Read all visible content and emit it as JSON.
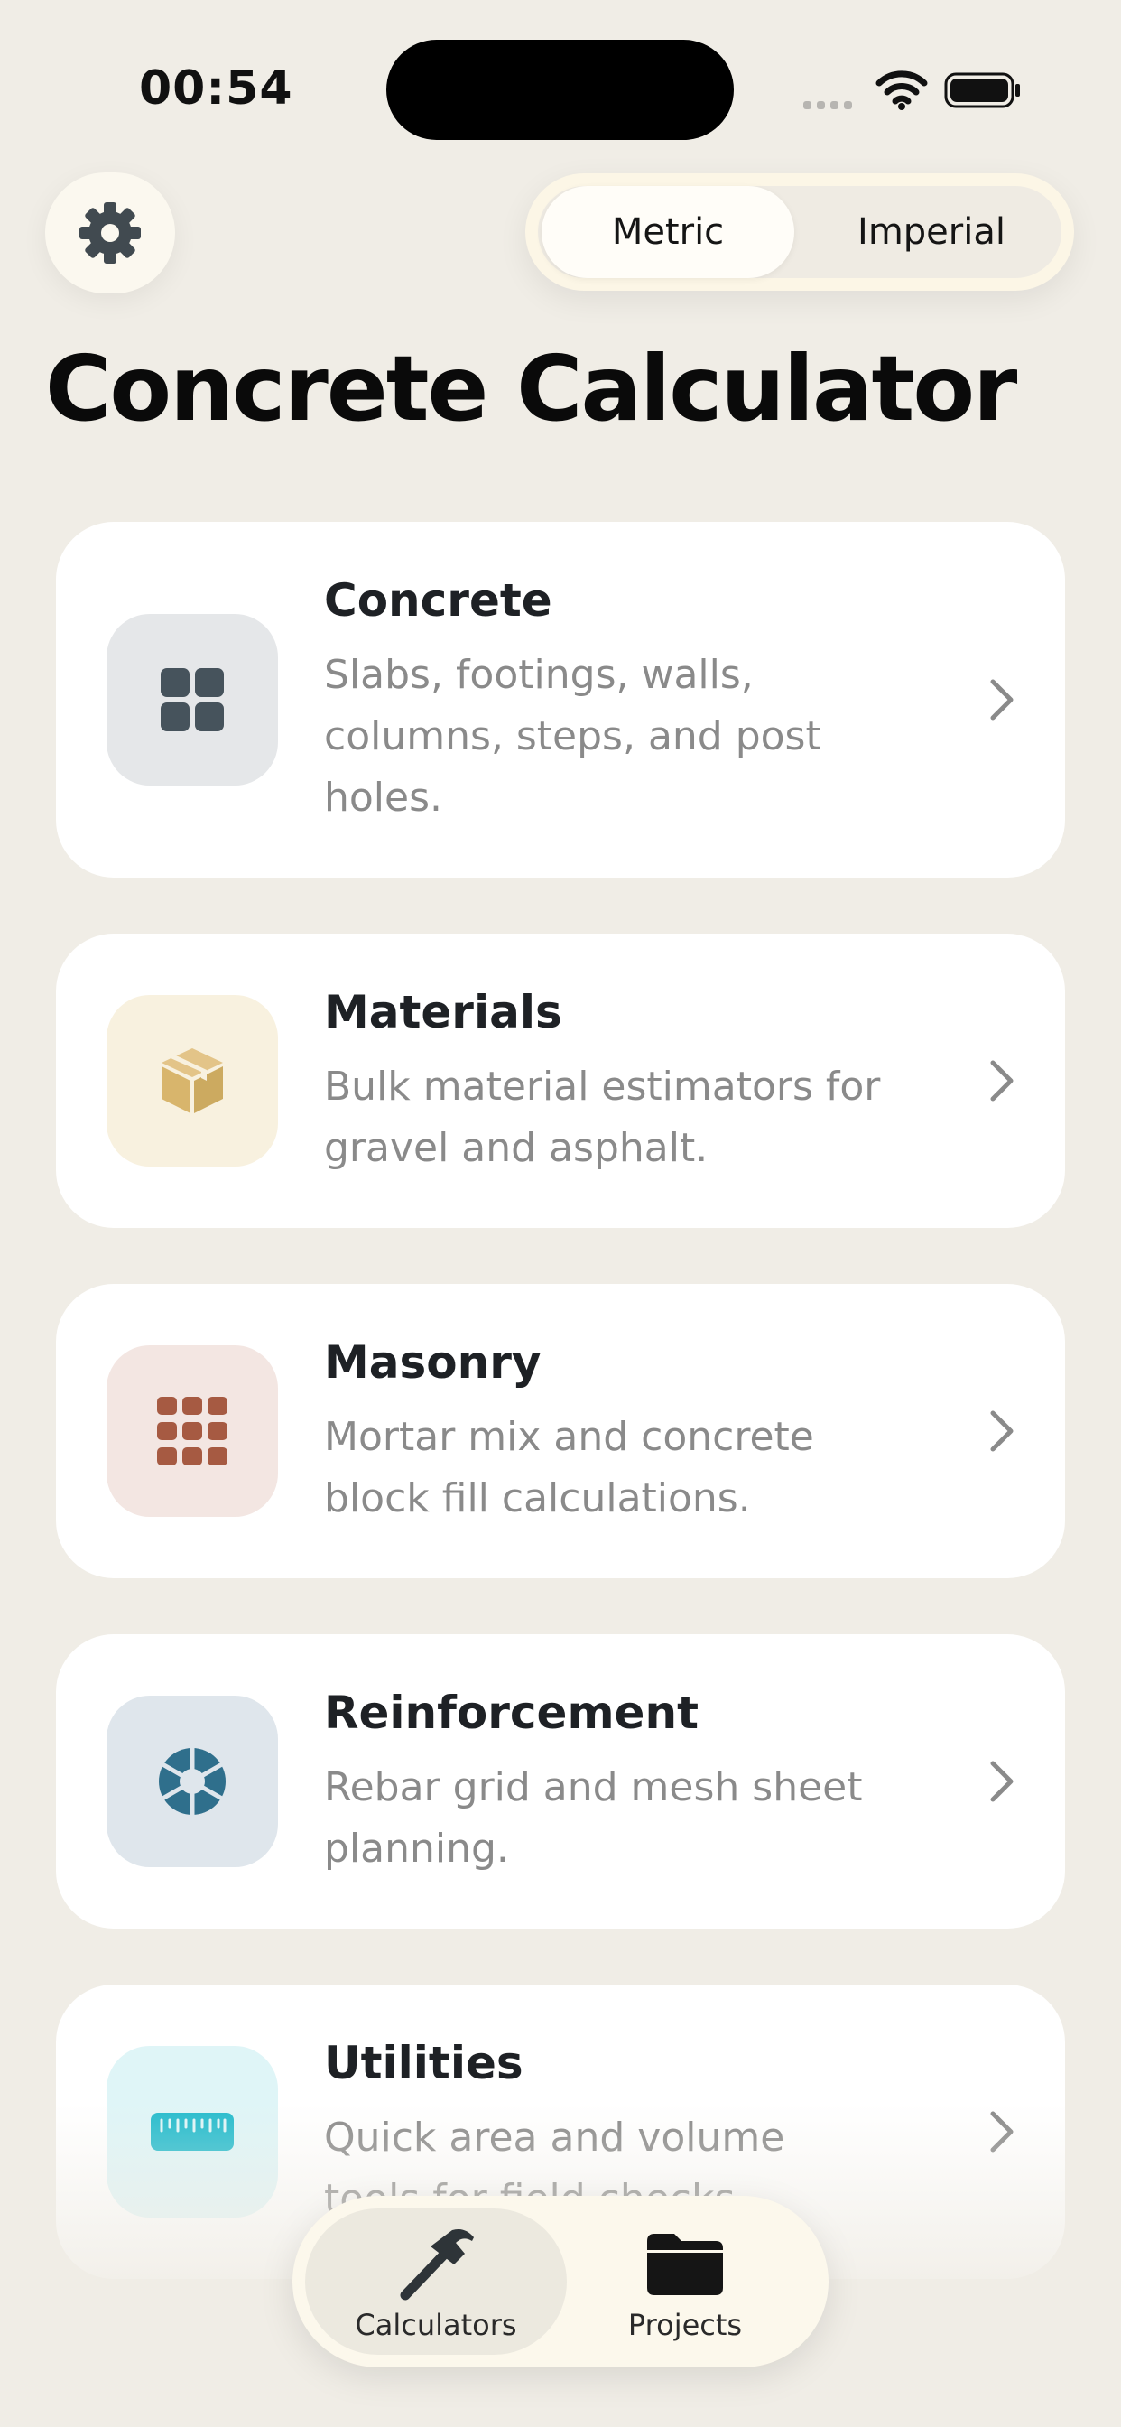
{
  "status_bar": {
    "time": "00:54"
  },
  "header": {
    "settings_icon": "gear-icon",
    "unit_toggle": {
      "options": [
        "Metric",
        "Imperial"
      ],
      "selected": "Metric"
    }
  },
  "page_title": "Concrete Calculator",
  "categories": [
    {
      "title": "Concrete",
      "description": "Slabs, footings, walls, columns, steps, and post holes.",
      "icon": "grid-icon",
      "icon_bg": "#e5e7e9",
      "icon_color": "#46535c"
    },
    {
      "title": "Materials",
      "description": "Bulk material estimators for gravel and asphalt.",
      "icon": "box-icon",
      "icon_bg": "#f8f1df",
      "icon_color": "#d8b56c"
    },
    {
      "title": "Masonry",
      "description": "Mortar mix and concrete block fill calculations.",
      "icon": "bricks-icon",
      "icon_bg": "#f3e6e2",
      "icon_color": "#a65a42"
    },
    {
      "title": "Reinforcement",
      "description": "Rebar grid and mesh sheet planning.",
      "icon": "aperture-icon",
      "icon_bg": "#dfe6ec",
      "icon_color": "#2f6f8c"
    },
    {
      "title": "Utilities",
      "description": "Quick area and volume tools for field checks.",
      "icon": "ruler-icon",
      "icon_bg": "#dff5f7",
      "icon_color": "#27bccd"
    }
  ],
  "tab_bar": {
    "tabs": [
      {
        "label": "Calculators",
        "icon": "hammer-icon",
        "selected": true
      },
      {
        "label": "Projects",
        "icon": "folder-icon",
        "selected": false
      }
    ]
  }
}
